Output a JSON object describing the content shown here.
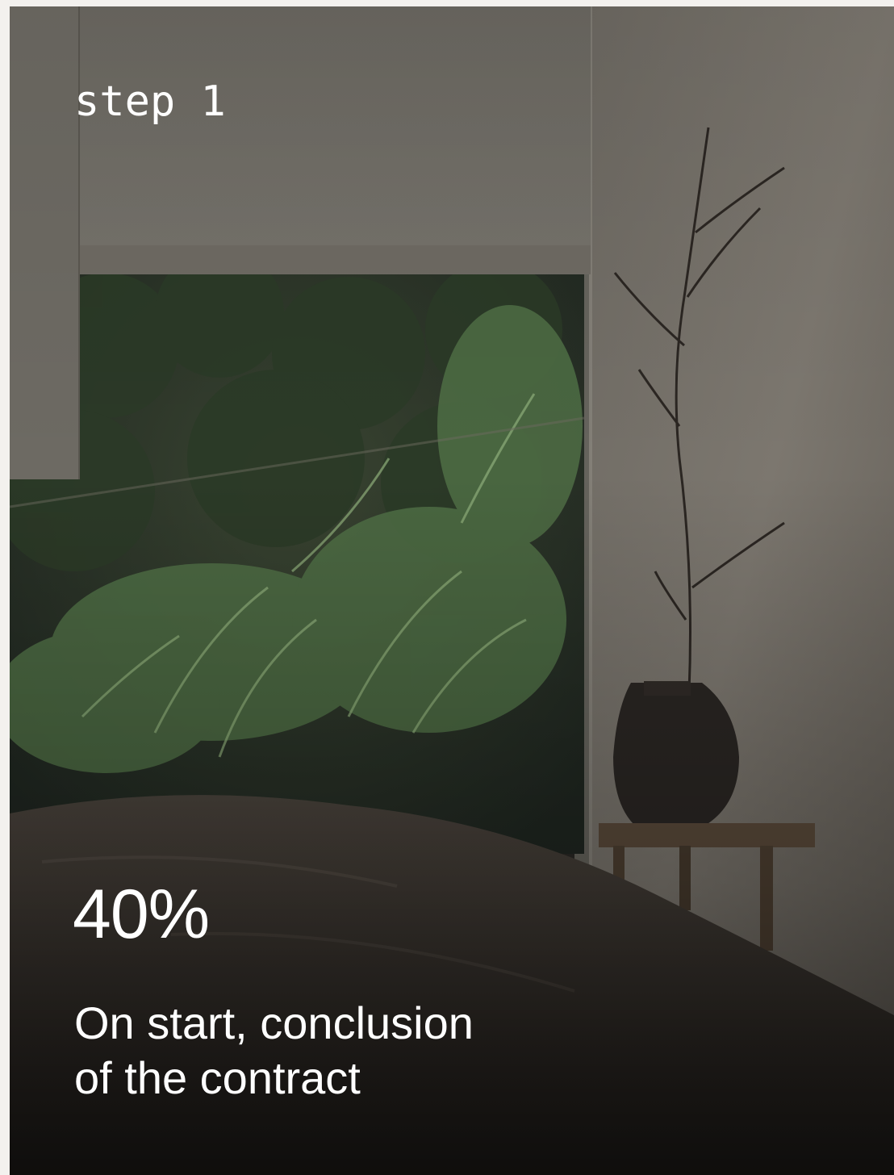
{
  "card": {
    "step_label": "step 1",
    "percent": "40%",
    "description_lines": [
      "On start, conclusion",
      "of the contract"
    ]
  },
  "colors": {
    "page_background": "#f3f1ee",
    "text": "#ffffff",
    "wall": "#8a857d",
    "foliage": "#3d5a34",
    "bedding": "#3b3530"
  }
}
